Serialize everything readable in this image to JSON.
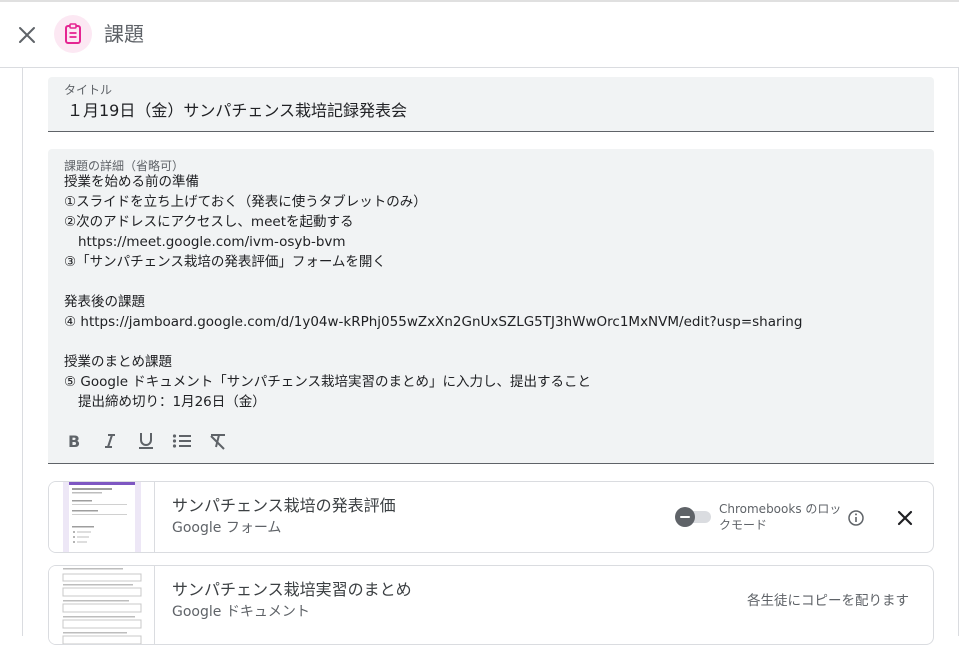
{
  "header": {
    "title": "課題",
    "close_icon": "close-icon",
    "assignment_icon": "assignment-icon",
    "accent": "#e52592"
  },
  "form": {
    "title_label": "タイトル",
    "title_value": "１月19日（金）サンパチェンス栽培記録発表会",
    "description_label": "課題の詳細（省略可）",
    "description_lines": [
      "授業を始める前の準備",
      "①スライドを立ち上げておく（発表に使うタブレットのみ）",
      "②次のアドレスにアクセスし、meetを起動する",
      "https://meet.google.com/ivm-osyb-bvm",
      "③「サンパチェンス栽培の発表評価」フォームを開く",
      "",
      "発表後の課題",
      "④ https://jamboard.google.com/d/1y04w-kRPhj055wZxXn2GnUxSZLG5TJ3hWwOrc1MxNVM/edit?usp=sharing",
      "",
      "授業のまとめ課題",
      "⑤ Google ドキュメント「サンパチェンス栽培実習のまとめ」に入力し、提出すること",
      "提出締め切り：1月26日（金）"
    ],
    "toolbar": [
      "bold-icon",
      "italic-icon",
      "underline-icon",
      "bulleted-list-icon",
      "clear-formatting-icon"
    ]
  },
  "attachments": [
    {
      "title": "サンパチェンス栽培の発表評価",
      "type": "Google フォーム",
      "lock_mode_label": "Chromebooks のロックモード",
      "lock_mode_on": false
    },
    {
      "title": "サンパチェンス栽培実習のまとめ",
      "type": "Google ドキュメント",
      "share_mode": "各生徒にコピーを配ります"
    }
  ]
}
